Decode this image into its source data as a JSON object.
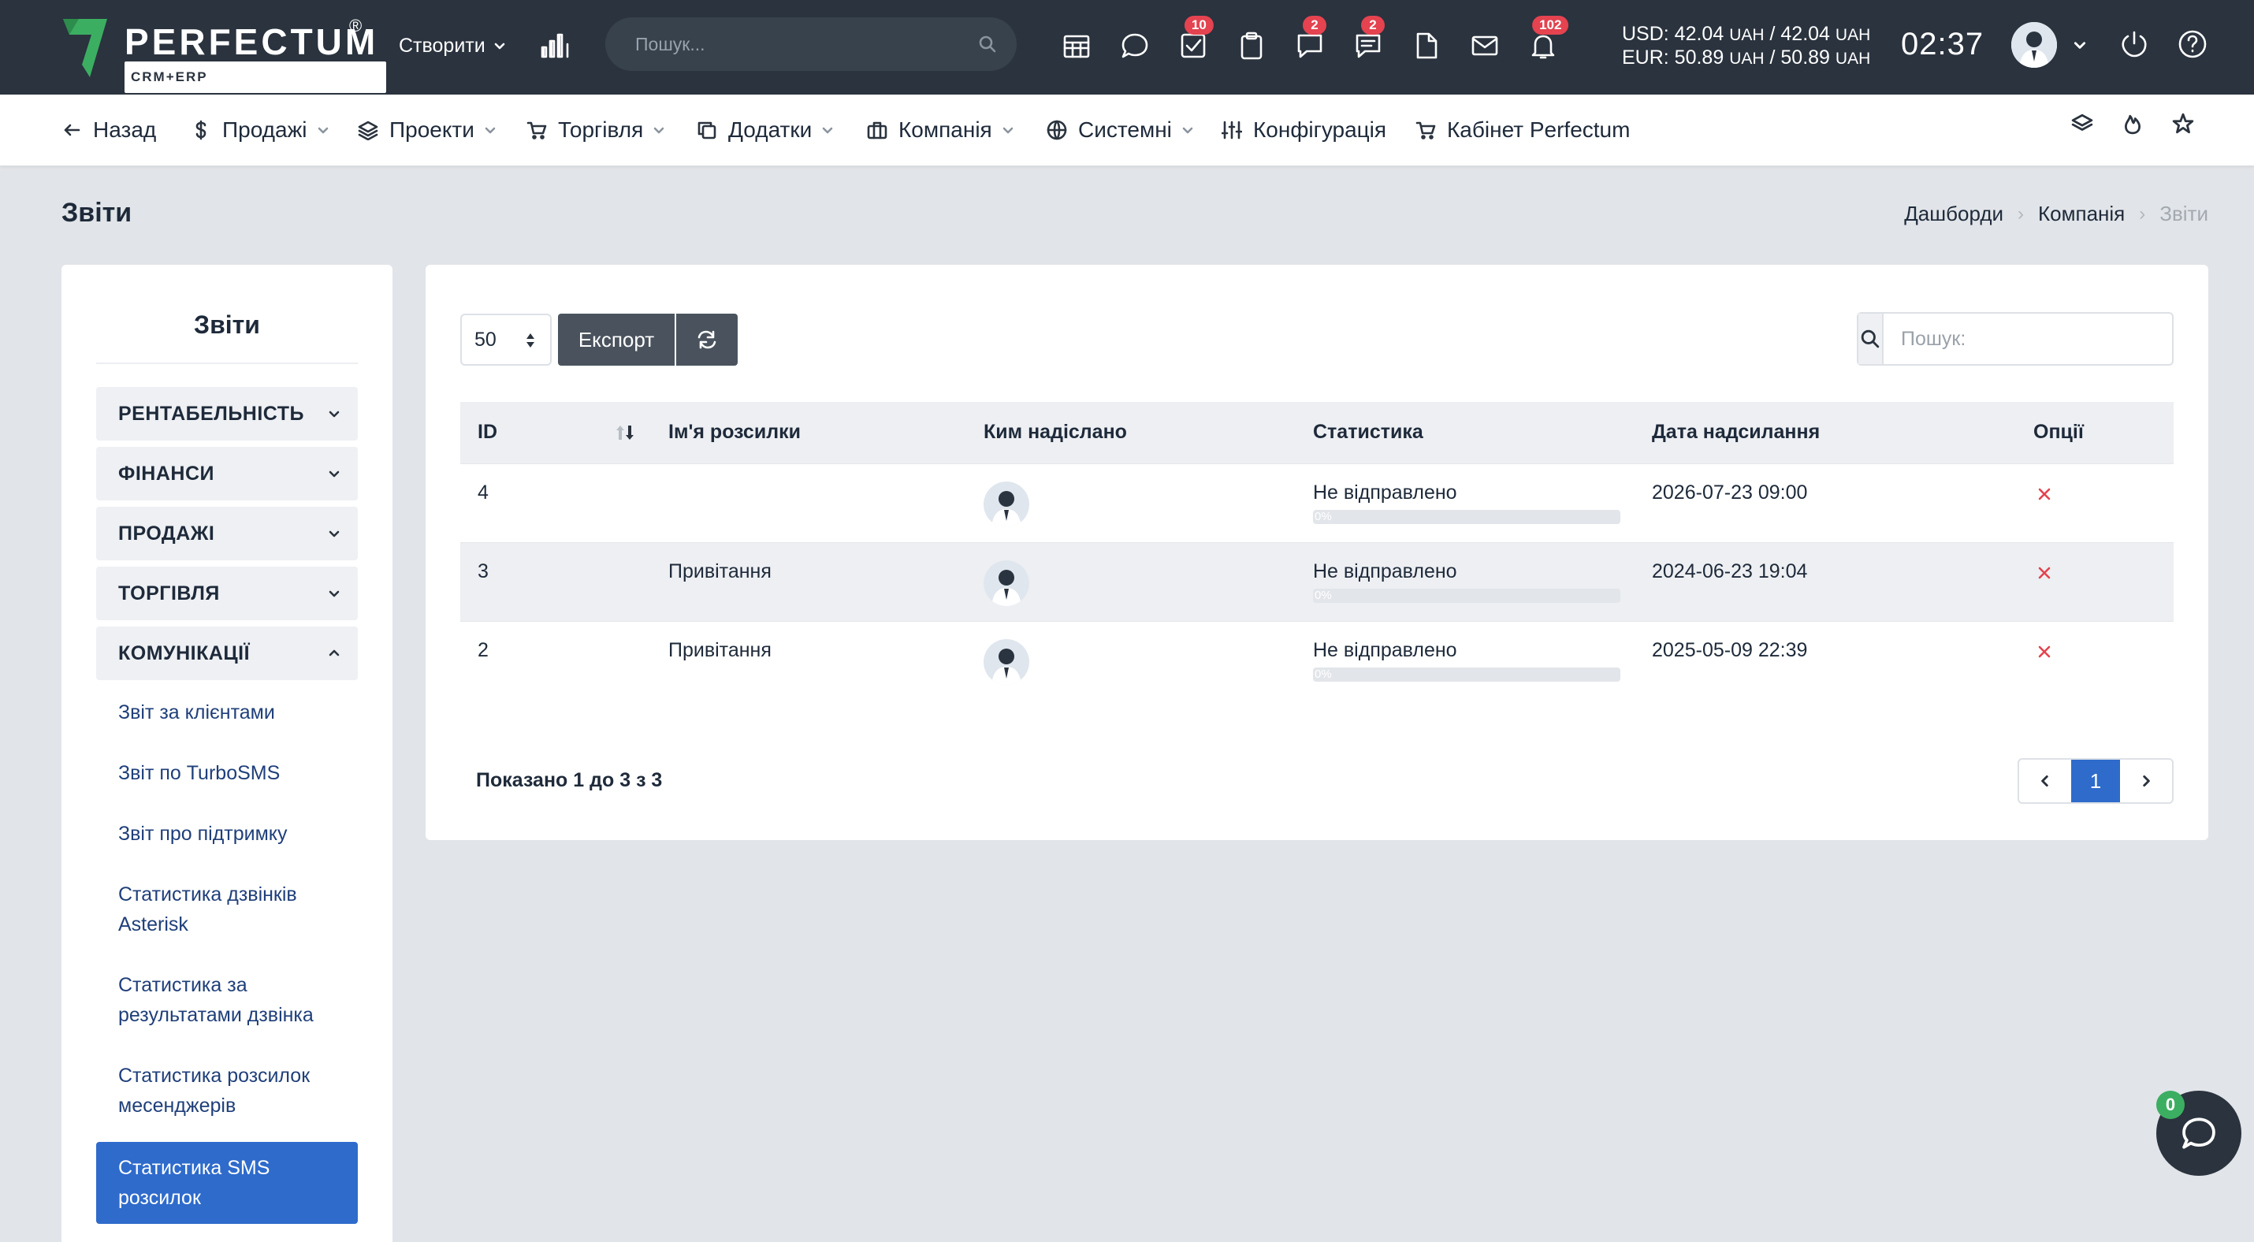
{
  "brand": {
    "name": "PERFECTUM",
    "reg": "®",
    "sub": "CRM+ERP"
  },
  "topbar": {
    "create_label": "Створити",
    "search_placeholder": "Пошук...",
    "badges": {
      "tasks": "10",
      "support": "2",
      "discussions": "2",
      "notifications": "102"
    },
    "currency_usd_prefix": "USD: 42.04",
    "currency_usd_mid": " / 42.04",
    "currency_eur_prefix": "EUR: 50.89",
    "currency_eur_mid": " / 50.89",
    "currency_unit": "UAH",
    "clock": "02:37"
  },
  "nav": {
    "back": "Назад",
    "sales": "Продажі",
    "projects": "Проекти",
    "trade": "Торгівля",
    "addons": "Додатки",
    "company": "Компанія",
    "system": "Системні",
    "config": "Конфігурація",
    "cabinet": "Кабінет Perfectum"
  },
  "page": {
    "title": "Звіти",
    "breadcrumb": [
      "Дашборди",
      "Компанія",
      "Звіти"
    ]
  },
  "sidebar": {
    "title": "Звіти",
    "sections": [
      "РЕНТАБЕЛЬНІСТЬ",
      "ФІНАНСИ",
      "ПРОДАЖІ",
      "ТОРГІВЛЯ",
      "КОМУНІКАЦІЇ"
    ],
    "items": [
      "Звіт за клієнтами",
      "Звіт по TurboSMS",
      "Звіт про підтримку",
      "Статистика дзвінків Asterisk",
      "Статистика за результатами дзвінка",
      "Статистика розсилок месенджерів",
      "Статистика SMS розсилок"
    ],
    "active_item": "Статистика SMS розсилок"
  },
  "toolbar": {
    "page_size": "50",
    "export_label": "Експорт",
    "search_placeholder": "Пошук:"
  },
  "table": {
    "columns": [
      "ID",
      "Ім'я розсилки",
      "Ким надіслано",
      "Статистика",
      "Дата надсилання",
      "Опції"
    ],
    "rows": [
      {
        "id": "4",
        "name": "",
        "status": "Не відправлено",
        "progress_label": "0%",
        "progress": 0,
        "date": "2026-07-23 09:00"
      },
      {
        "id": "3",
        "name": "Привітання",
        "status": "Не відправлено",
        "progress_label": "0%",
        "progress": 0,
        "date": "2024-06-23 19:04"
      },
      {
        "id": "2",
        "name": "Привітання",
        "status": "Не відправлено",
        "progress_label": "0%",
        "progress": 0,
        "date": "2025-05-09 22:39"
      }
    ]
  },
  "footer": {
    "showing": "Показано 1 до 3 з 3",
    "current_page": "1"
  },
  "chat": {
    "badge": "0"
  },
  "colors": {
    "topbar": "#2a333e",
    "accent": "#2e6bcb",
    "danger": "#e4434f",
    "logo_green": "#3cae62"
  }
}
